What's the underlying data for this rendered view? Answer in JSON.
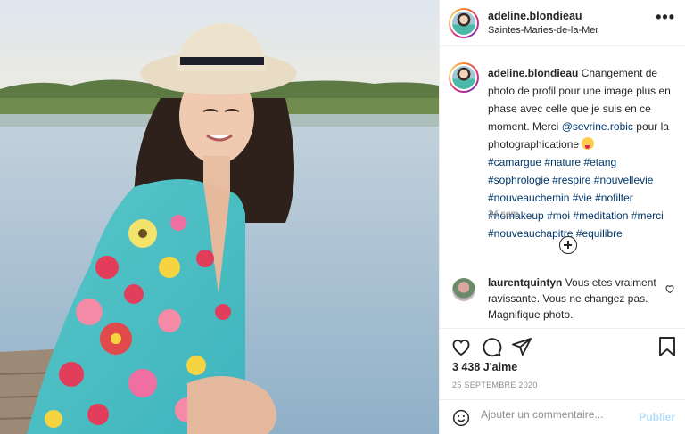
{
  "header": {
    "username": "adeline.blondieau",
    "location": "Saintes-Maries-de-la-Mer",
    "more_icon": "more-options-icon"
  },
  "caption": {
    "username": "adeline.blondieau",
    "text_1": "Changement de photo de profil pour une image plus en phase avec celle que je suis en ce moment. Merci",
    "mention": "@sevrine.robic",
    "text_2": "pour la photographicatione",
    "hashtags": [
      "#camargue",
      "#nature",
      "#etang",
      "#sophrologie",
      "#respire",
      "#nouvellevie",
      "#nouveauchemin",
      "#vie",
      "#nofilter",
      "#nomakeup",
      "#moi",
      "#meditation",
      "#merci",
      "#nouveauchapitre",
      "#equilibre"
    ],
    "time_ago": "34 sem"
  },
  "comment": {
    "username": "laurentquintyn",
    "text": "Vous etes vraiment ravissante. Vous ne changez pas. Magnifique photo."
  },
  "actions": {
    "likes": "3 438 J'aime",
    "date": "25 SEPTEMBRE 2020",
    "icons": [
      "heart-icon",
      "comment-icon",
      "share-icon",
      "bookmark-icon"
    ]
  },
  "add_comment": {
    "placeholder": "Ajouter un commentaire...",
    "publish_label": "Publier"
  },
  "colors": {
    "link": "#00376b",
    "publish_disabled": "#b2dffc",
    "secondary_text": "#8e8e8e"
  }
}
